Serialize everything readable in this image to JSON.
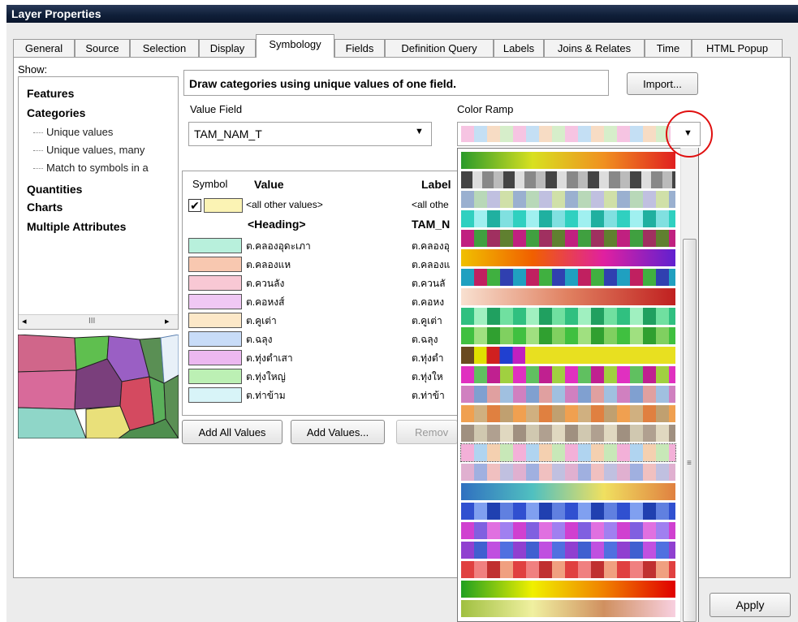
{
  "window": {
    "title": "Layer Properties"
  },
  "tabs": [
    "General",
    "Source",
    "Selection",
    "Display",
    "Symbology",
    "Fields",
    "Definition Query",
    "Labels",
    "Joins & Relates",
    "Time",
    "HTML Popup"
  ],
  "active_tab": "Symbology",
  "show": {
    "label": "Show:",
    "features": "Features",
    "categories": "Categories",
    "unique_values": "Unique values",
    "unique_values_many": "Unique values, many",
    "match_symbols": "Match to symbols in a",
    "quantities": "Quantities",
    "charts": "Charts",
    "multiple_attributes": "Multiple Attributes",
    "scroll_grip": "III"
  },
  "description": "Draw categories using unique values of one field.",
  "import_button": "Import...",
  "value_field": {
    "label": "Value Field",
    "value": "TAM_NAM_T"
  },
  "color_ramp_label": "Color Ramp",
  "table": {
    "col_symbol": "Symbol",
    "col_value": "Value",
    "col_label": "Label",
    "all_other_value": "<all other values>",
    "all_other_label": "<all othe",
    "heading_value": "<Heading>",
    "heading_label": "TAM_N",
    "rows": [
      {
        "value": "ต.คลองอุดะเภา",
        "label": "ต.คลองอุ",
        "color": "#b8f0dc"
      },
      {
        "value": "ต.คลองแห",
        "label": "ต.คลองแ",
        "color": "#f8c8b0"
      },
      {
        "value": "ต.ควนลัง",
        "label": "ต.ควนลั",
        "color": "#f8c8d4"
      },
      {
        "value": "ต.คอหงส์",
        "label": "ต.คอหง",
        "color": "#f0c8f4"
      },
      {
        "value": "ต.คูเต่า",
        "label": "ต.คูเต่า",
        "color": "#fce8c8"
      },
      {
        "value": "ต.ฉลุง",
        "label": "ต.ฉลุง",
        "color": "#c8dcf8"
      },
      {
        "value": "ต.ทุ่งตำเสา",
        "label": "ต.ทุ่งตำ",
        "color": "#ecb8f0"
      },
      {
        "value": "ต.ทุ่งใหญ่",
        "label": "ต.ทุ่งให",
        "color": "#bcf0b4"
      },
      {
        "value": "ต.ท่าข้าม",
        "label": "ต.ท่าข้า",
        "color": "#d8f4f8"
      }
    ]
  },
  "buttons": {
    "add_all": "Add All Values",
    "add_values": "Add Values...",
    "remove": "Remov",
    "apply": "Apply"
  },
  "colors": {
    "highlight_circle": "#e01010",
    "title_bar": "#10203a"
  }
}
